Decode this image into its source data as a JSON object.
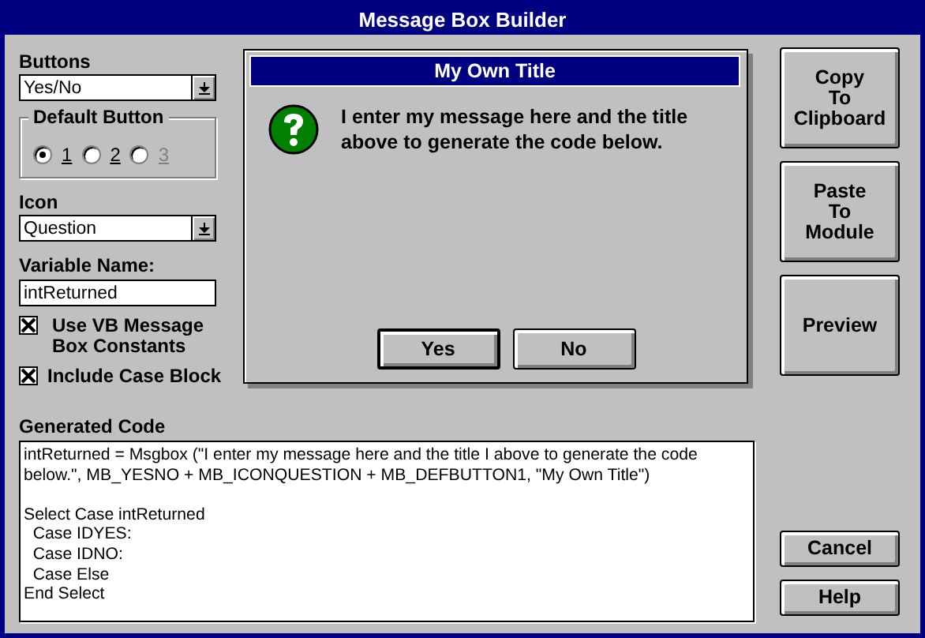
{
  "window": {
    "title": "Message Box Builder"
  },
  "buttons_field": {
    "label": "Buttons",
    "value": "Yes/No"
  },
  "default_button": {
    "label": "Default Button",
    "options": [
      {
        "label": "1",
        "selected": true,
        "disabled": false
      },
      {
        "label": "2",
        "selected": false,
        "disabled": false
      },
      {
        "label": "3",
        "selected": false,
        "disabled": true
      }
    ]
  },
  "icon_field": {
    "label": "Icon",
    "value": "Question"
  },
  "variable_name": {
    "label": "Variable Name:",
    "value": "intReturned"
  },
  "checkboxes": [
    {
      "label": "Use VB Message Box Constants",
      "checked": true
    },
    {
      "label": "Include Case Block",
      "checked": true
    }
  ],
  "preview": {
    "title": "My Own Title",
    "kind": "question",
    "message": "I enter my message here and the title above to generate the code below.",
    "buttons": [
      {
        "label": "Yes",
        "default": true
      },
      {
        "label": "No",
        "default": false
      }
    ]
  },
  "actions": [
    {
      "lines": [
        "Copy",
        "To",
        "Clipboard"
      ]
    },
    {
      "lines": [
        "Paste",
        "To",
        "Module"
      ]
    },
    {
      "lines": [
        "Preview"
      ]
    }
  ],
  "generated_code": {
    "label": "Generated Code",
    "blocks": [
      [
        "intReturned = Msgbox (\"I enter my message here and the title I above to generate the code",
        "below.\", MB_YESNO + MB_ICONQUESTION + MB_DEFBUTTON1, \"My Own Title\")"
      ],
      [
        "Select Case intReturned",
        "  Case IDYES:",
        "  Case IDNO:",
        "  Case Else",
        "End Select"
      ]
    ]
  },
  "footer_buttons": [
    "Cancel",
    "Help"
  ]
}
